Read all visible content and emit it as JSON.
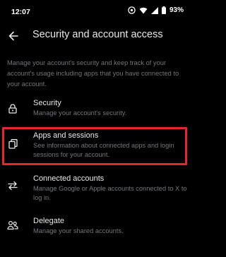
{
  "status_bar": {
    "time": "12:07",
    "battery": "93%",
    "icons": [
      "settings-circle-icon",
      "wifi-icon",
      "signal-icon",
      "battery-icon"
    ]
  },
  "header": {
    "title": "Security and account access",
    "back_icon": "arrow-left-icon"
  },
  "description": "Manage your account's security and keep track of your account's usage including apps that you have connected to your account.",
  "items": [
    {
      "icon": "lock-icon",
      "title": "Security",
      "subtitle": "Manage your account's security."
    },
    {
      "icon": "copy-icon",
      "title": "Apps and sessions",
      "subtitle": "See information about connected apps and login sessions for your account."
    },
    {
      "icon": "swap-arrows-icon",
      "title": "Connected accounts",
      "subtitle": "Manage Google or Apple accounts connected to X to log in."
    },
    {
      "icon": "people-icon",
      "title": "Delegate",
      "subtitle": "Manage your shared accounts."
    }
  ],
  "colors": {
    "background": "#000000",
    "text_primary": "#e7e9ea",
    "text_secondary": "#71767b",
    "highlight": "#e0282e"
  }
}
